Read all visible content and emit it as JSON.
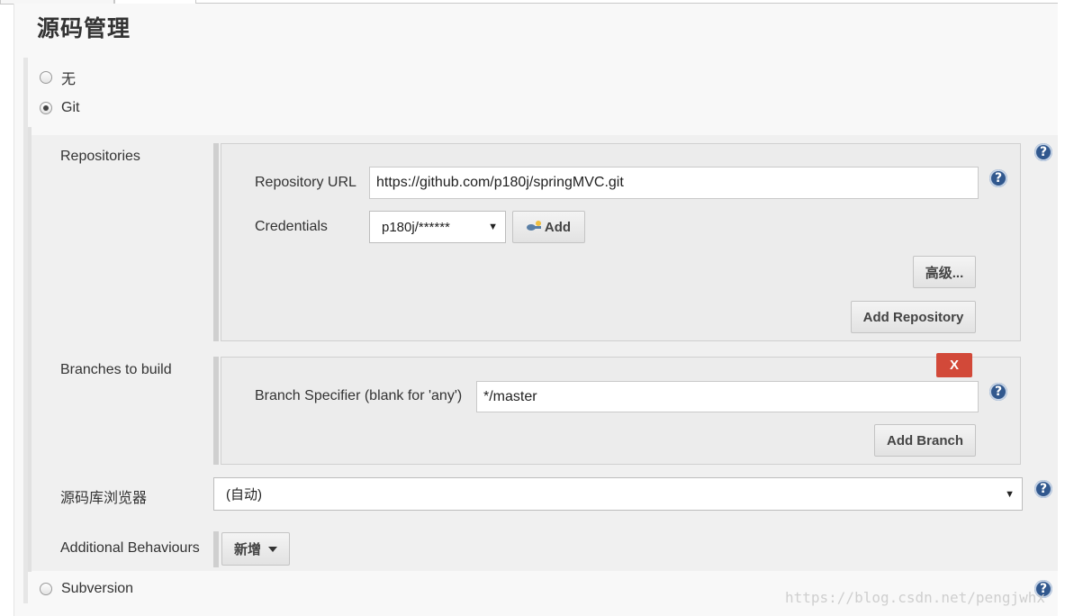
{
  "section_title": "源码管理",
  "scm_options": {
    "none_label": "无",
    "git_label": "Git",
    "subversion_label": "Subversion"
  },
  "git": {
    "repositories_label": "Repositories",
    "repository_url_label": "Repository URL",
    "repository_url_value": "https://github.com/p180j/springMVC.git",
    "credentials_label": "Credentials",
    "credentials_selected": "p180j/******",
    "add_credentials_label": "Add",
    "advanced_button_label": "高级...",
    "add_repository_label": "Add Repository",
    "branches_label": "Branches to build",
    "delete_branch_label": "X",
    "branch_specifier_label": "Branch Specifier (blank for 'any')",
    "branch_specifier_value": "*/master",
    "add_branch_label": "Add Branch",
    "repo_browser_label": "源码库浏览器",
    "repo_browser_selected": "(自动)",
    "additional_behaviours_label": "Additional Behaviours",
    "add_behaviour_label": "新增"
  },
  "help_symbol": "?",
  "watermark": "https://blog.csdn.net/pengjwhx"
}
